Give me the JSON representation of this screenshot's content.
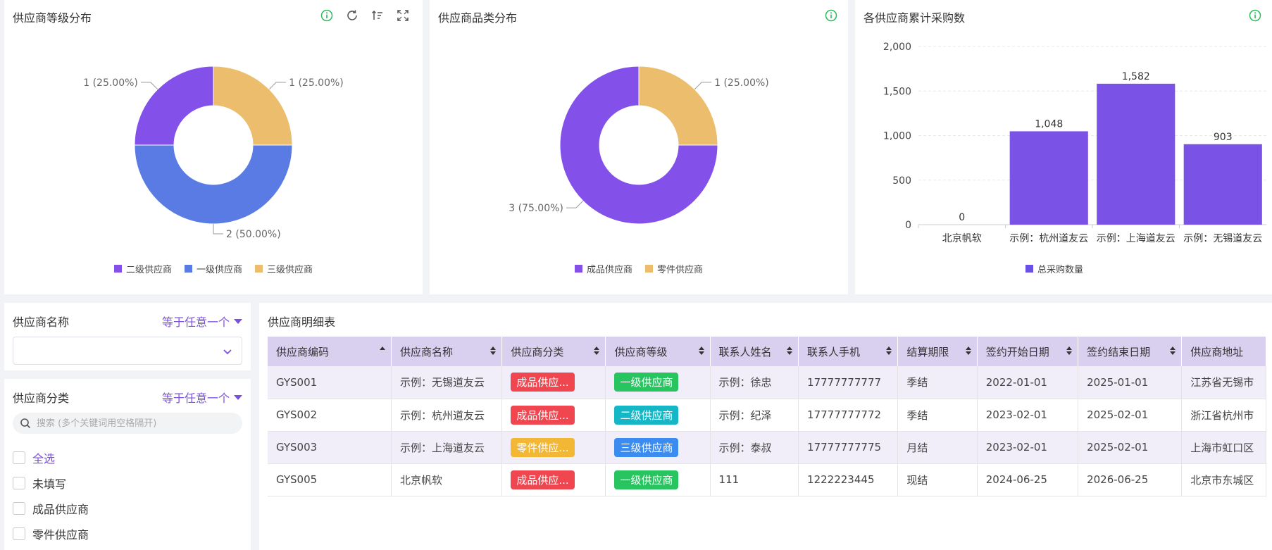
{
  "colors": {
    "purple": "#8350ea",
    "blue": "#5a7be3",
    "gold": "#ebbd6c",
    "bar": "#7b52e6",
    "accent": "#7b4fe0",
    "info_icon": "#2dbb5e",
    "tag_red": "#f0464f",
    "tag_green": "#27c460",
    "tag_teal": "#15b7c6",
    "tag_blue": "#3b8cf0",
    "tag_gold": "#f2b734"
  },
  "panel_grade": {
    "title": "供应商等级分布",
    "tools": [
      "info-icon",
      "refresh-icon",
      "sort-icon",
      "fullscreen-icon"
    ],
    "chart_data": {
      "type": "pie",
      "labels": [
        "二级供应商",
        "一级供应商",
        "三级供应商"
      ],
      "values": [
        1,
        2,
        1
      ],
      "slice_labels": [
        "1 (25.00%)",
        "2 (50.00%)",
        "1 (25.00%)"
      ],
      "legend": [
        "二级供应商",
        "一级供应商",
        "三级供应商"
      ]
    }
  },
  "panel_category": {
    "title": "供应商品类分布",
    "chart_data": {
      "type": "pie",
      "labels": [
        "成品供应商",
        "零件供应商"
      ],
      "values": [
        3,
        1
      ],
      "slice_labels": [
        "3 (75.00%)",
        "1 (25.00%)"
      ],
      "legend": [
        "成品供应商",
        "零件供应商"
      ]
    }
  },
  "panel_purchase": {
    "title": "各供应商累计采购数",
    "chart_data": {
      "type": "bar",
      "categories": [
        "北京帆软",
        "示例：杭州道友云",
        "示例：上海道友云",
        "示例：无锡道友云"
      ],
      "series": [
        {
          "name": "总采购数量",
          "values": [
            0,
            1048,
            1582,
            903
          ]
        }
      ],
      "value_labels": [
        "0",
        "1,048",
        "1,582",
        "903"
      ],
      "yticks": [
        "0",
        "500",
        "1,000",
        "1,500",
        "2,000"
      ],
      "ylim": [
        0,
        2000
      ],
      "legend": "bottom"
    }
  },
  "filter_name": {
    "label": "供应商名称",
    "operator": "等于任意一个"
  },
  "filter_category": {
    "label": "供应商分类",
    "operator": "等于任意一个",
    "search_placeholder": "搜索 (多个关键词用空格隔开)",
    "options": [
      "全选",
      "未填写",
      "成品供应商",
      "零件供应商"
    ]
  },
  "table": {
    "title": "供应商明细表",
    "columns": [
      "供应商编码",
      "供应商名称",
      "供应商分类",
      "供应商等级",
      "联系人姓名",
      "联系人手机",
      "结算期限",
      "签约开始日期",
      "签约结束日期",
      "供应商地址"
    ],
    "rows": [
      [
        "GYS001",
        "示例：无锡道友云",
        "成品供应...",
        "一级供应商",
        "示例：徐忠",
        "17777777777",
        "季结",
        "2022-01-01",
        "2025-01-01",
        "江苏省无锡市"
      ],
      [
        "GYS002",
        "示例：杭州道友云",
        "成品供应...",
        "二级供应商",
        "示例：纪泽",
        "17777777772",
        "季结",
        "2023-02-01",
        "2025-02-01",
        "浙江省杭州市"
      ],
      [
        "GYS003",
        "示例：上海道友云",
        "零件供应...",
        "三级供应商",
        "示例：泰叔",
        "17777777775",
        "月结",
        "2023-02-01",
        "2025-02-01",
        "上海市虹口区"
      ],
      [
        "GYS005",
        "北京帆软",
        "成品供应...",
        "一级供应商",
        "111",
        "1222223445",
        "现结",
        "2024-06-25",
        "2026-06-25",
        "北京市东城区"
      ]
    ]
  }
}
